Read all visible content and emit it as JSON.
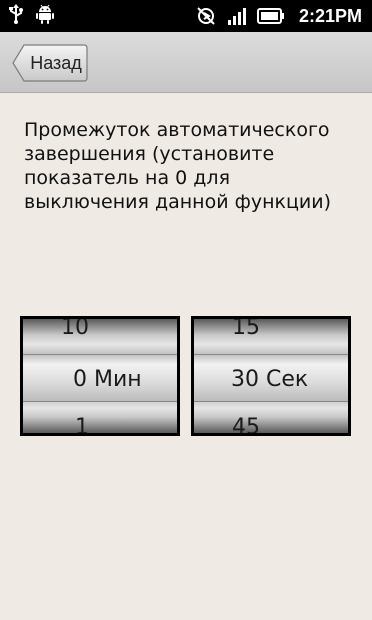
{
  "status_bar": {
    "time": "2:21PM",
    "icons": [
      "usb-icon",
      "android-debug-icon",
      "sync-icon",
      "signal-icon",
      "battery-icon"
    ]
  },
  "header": {
    "back_label": "Назад"
  },
  "description": "Промежуток автоматического завершения (установите показатель на 0 для выключения данной функции)",
  "minutes_wheel": {
    "prev": "10",
    "current": "0 Мин",
    "next": "1"
  },
  "seconds_wheel": {
    "prev": "15",
    "current": "30 Сек",
    "next": "45"
  }
}
